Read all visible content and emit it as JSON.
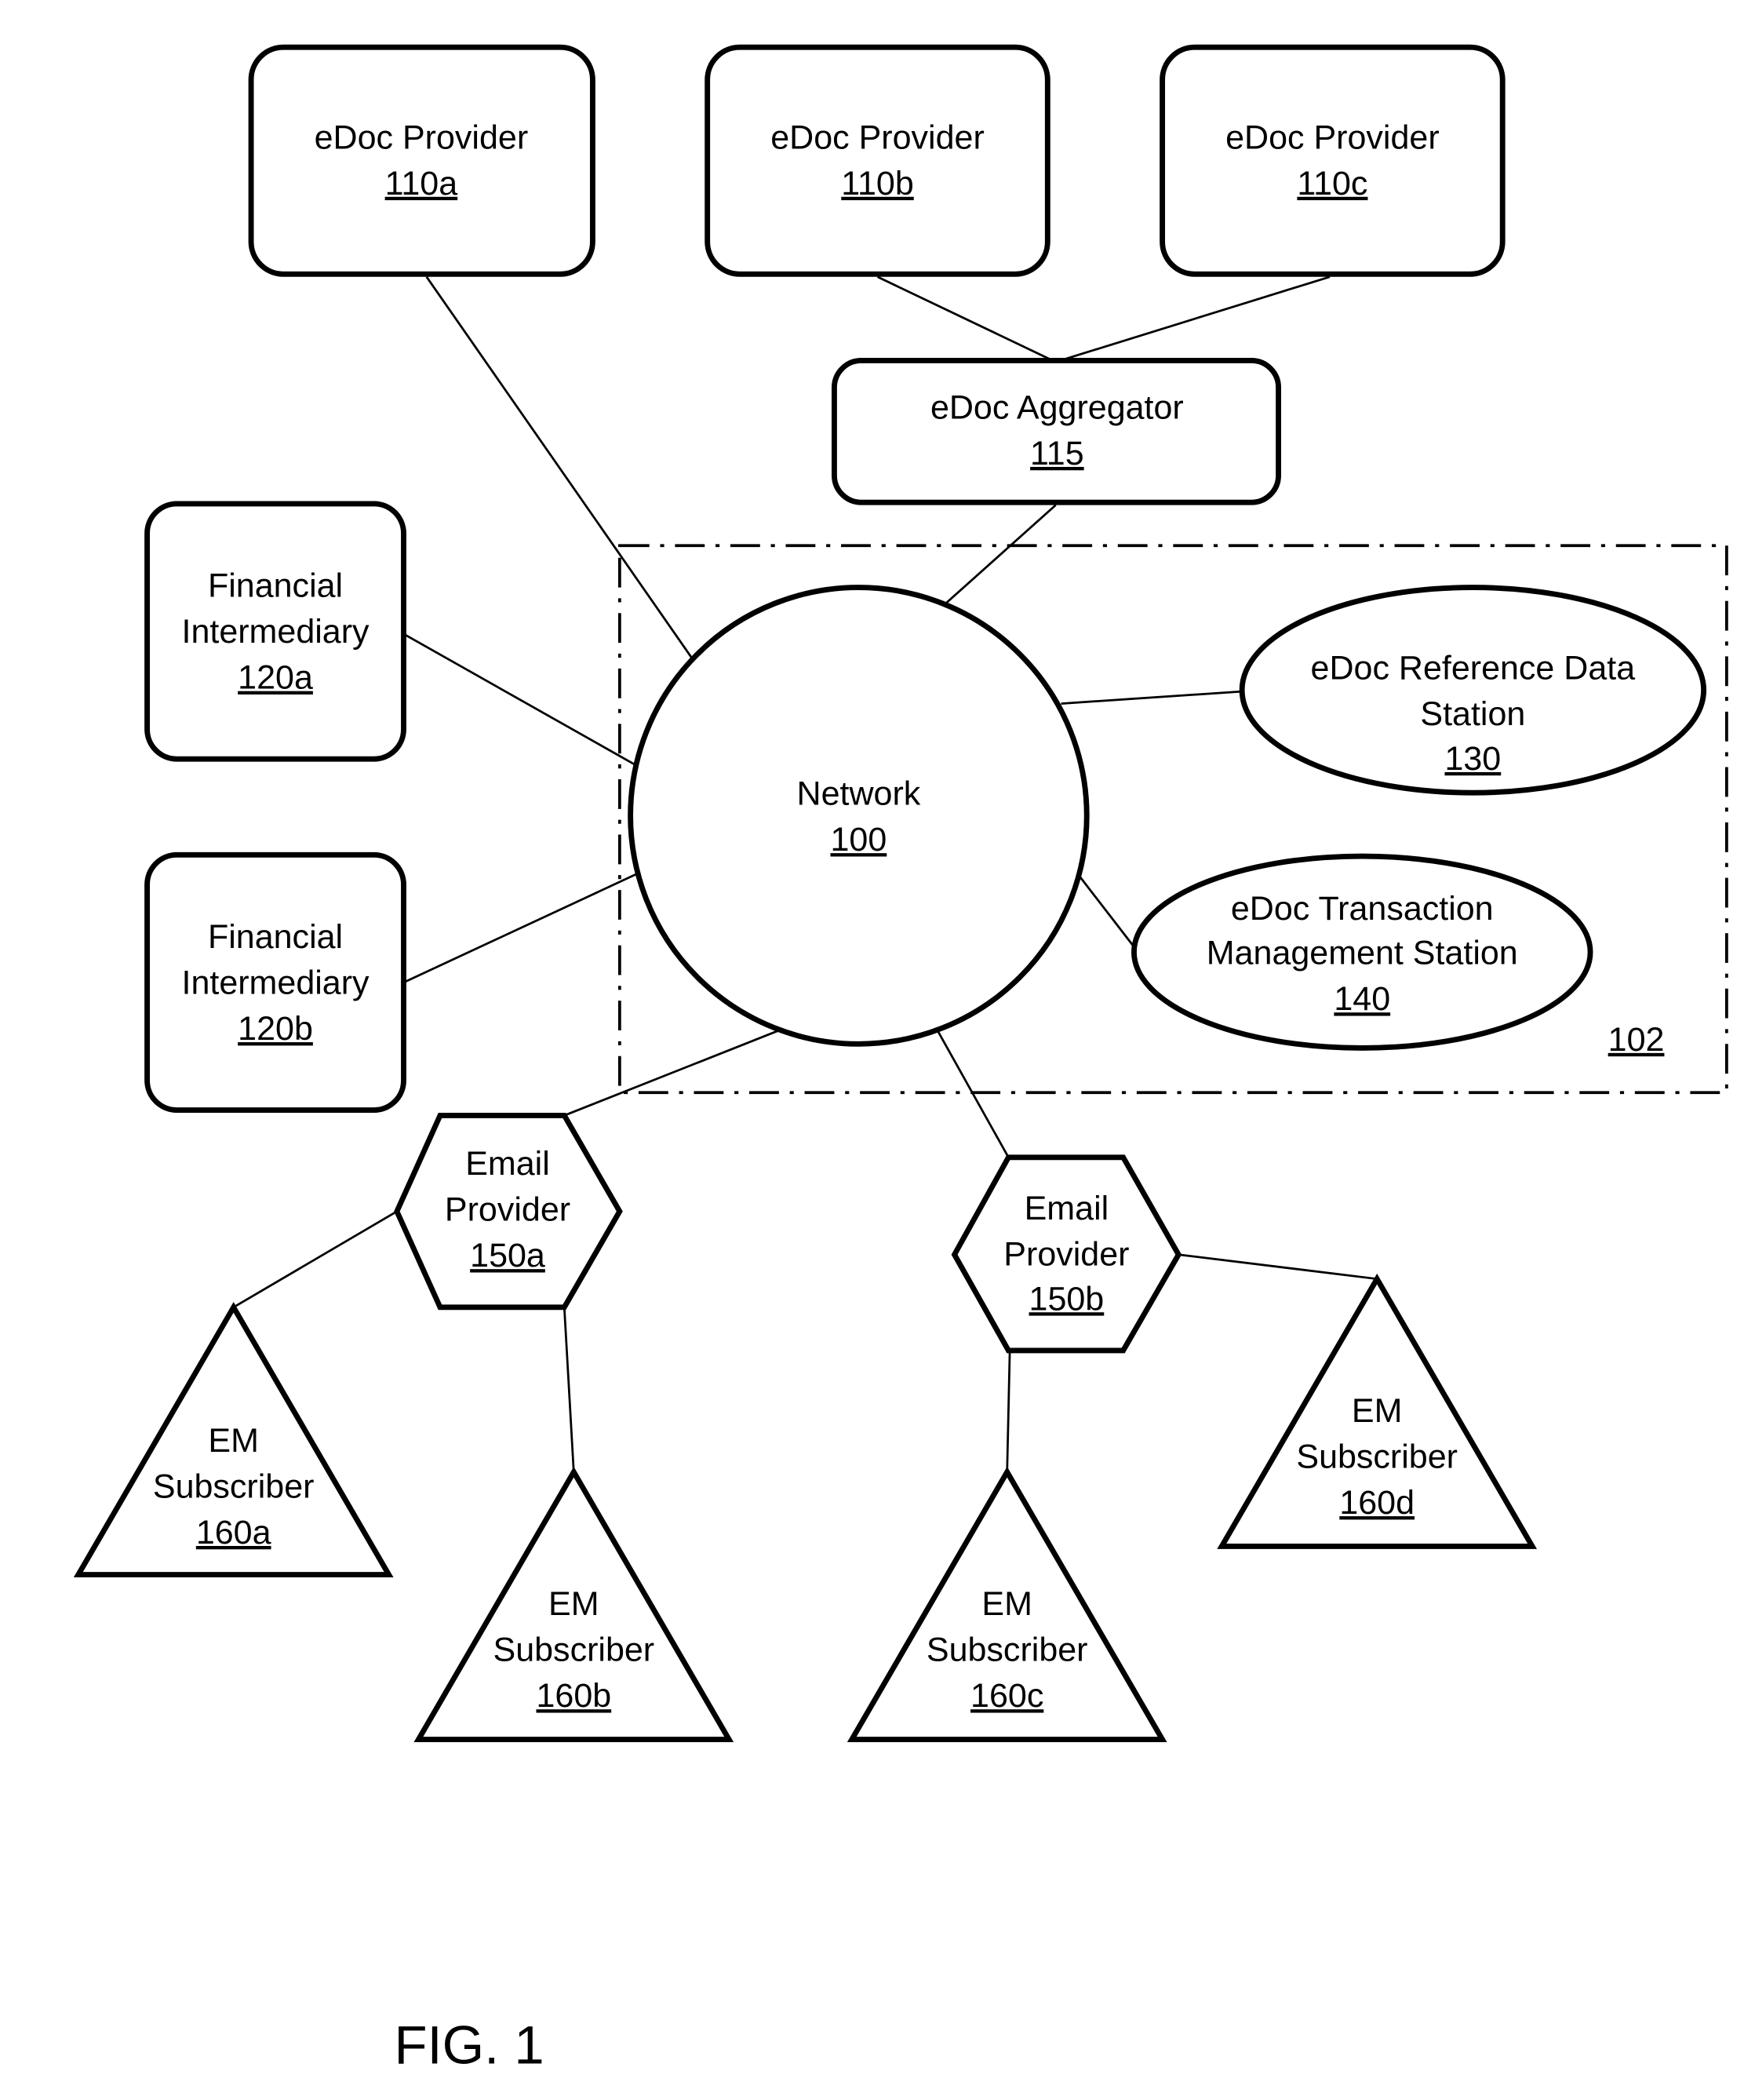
{
  "figure": {
    "caption": "FIG. 1",
    "boundary": {
      "ref": "102"
    },
    "nodes": {
      "edoc_provider_a": {
        "lines": [
          "eDoc Provider"
        ],
        "ref": "110a"
      },
      "edoc_provider_b": {
        "lines": [
          "eDoc Provider"
        ],
        "ref": "110b"
      },
      "edoc_provider_c": {
        "lines": [
          "eDoc Provider"
        ],
        "ref": "110c"
      },
      "edoc_aggregator": {
        "lines": [
          "eDoc Aggregator"
        ],
        "ref": "115"
      },
      "financial_intermediary_a": {
        "lines": [
          "Financial",
          "Intermediary"
        ],
        "ref": "120a"
      },
      "financial_intermediary_b": {
        "lines": [
          "Financial",
          "Intermediary"
        ],
        "ref": "120b"
      },
      "network": {
        "lines": [
          "Network"
        ],
        "ref": "100"
      },
      "reference_data_station": {
        "lines": [
          "eDoc Reference Data",
          "Station"
        ],
        "ref": "130"
      },
      "transaction_management_station": {
        "lines": [
          "eDoc Transaction",
          "Management Station"
        ],
        "ref": "140"
      },
      "email_provider_a": {
        "lines": [
          "Email",
          "Provider"
        ],
        "ref": "150a"
      },
      "email_provider_b": {
        "lines": [
          "Email",
          "Provider"
        ],
        "ref": "150b"
      },
      "em_subscriber_a": {
        "lines": [
          "EM",
          "Subscriber"
        ],
        "ref": "160a"
      },
      "em_subscriber_b": {
        "lines": [
          "EM",
          "Subscriber"
        ],
        "ref": "160b"
      },
      "em_subscriber_c": {
        "lines": [
          "EM",
          "Subscriber"
        ],
        "ref": "160c"
      },
      "em_subscriber_d": {
        "lines": [
          "EM",
          "Subscriber"
        ],
        "ref": "160d"
      }
    },
    "connections": [
      [
        "edoc_provider_a",
        "network"
      ],
      [
        "edoc_provider_b",
        "edoc_aggregator"
      ],
      [
        "edoc_provider_c",
        "edoc_aggregator"
      ],
      [
        "edoc_aggregator",
        "network"
      ],
      [
        "financial_intermediary_a",
        "network"
      ],
      [
        "financial_intermediary_b",
        "network"
      ],
      [
        "network",
        "reference_data_station"
      ],
      [
        "network",
        "transaction_management_station"
      ],
      [
        "network",
        "email_provider_a"
      ],
      [
        "network",
        "email_provider_b"
      ],
      [
        "email_provider_a",
        "em_subscriber_a"
      ],
      [
        "email_provider_a",
        "em_subscriber_b"
      ],
      [
        "email_provider_b",
        "em_subscriber_c"
      ],
      [
        "email_provider_b",
        "em_subscriber_d"
      ]
    ]
  }
}
